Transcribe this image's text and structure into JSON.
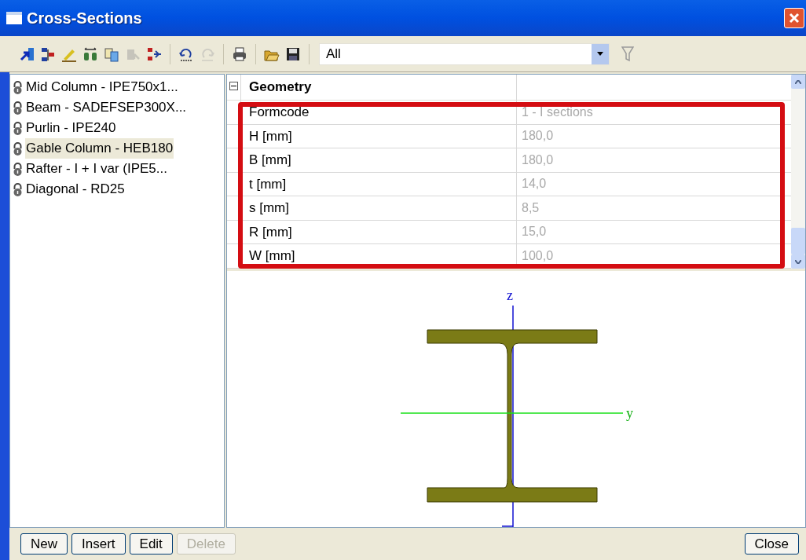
{
  "window": {
    "title": "Cross-Sections"
  },
  "toolbar": {
    "tools": [
      {
        "kind": "assign",
        "disabled": false
      },
      {
        "kind": "swap",
        "disabled": false
      },
      {
        "kind": "edit",
        "disabled": false
      },
      {
        "kind": "binoculars",
        "disabled": false
      },
      {
        "kind": "copy",
        "disabled": false
      },
      {
        "kind": "pointer",
        "disabled": true
      },
      {
        "kind": "insert",
        "disabled": false
      },
      {
        "kind": "undo",
        "disabled": false
      },
      {
        "kind": "redo",
        "disabled": true
      },
      {
        "kind": "print",
        "disabled": false
      },
      {
        "kind": "open",
        "disabled": false
      },
      {
        "kind": "save",
        "disabled": false
      }
    ],
    "filter": {
      "value": "All"
    }
  },
  "sections": [
    {
      "label": "Mid Column - IPE750x1...",
      "selected": false
    },
    {
      "label": "Beam - SADEFSEP300X...",
      "selected": false
    },
    {
      "label": "Purlin - IPE240",
      "selected": false
    },
    {
      "label": "Gable Column - HEB180",
      "selected": true
    },
    {
      "label": "Rafter - I + I var (IPE5...",
      "selected": false
    },
    {
      "label": "Diagonal - RD25",
      "selected": false
    }
  ],
  "properties": {
    "group": "Geometry",
    "expanded": true,
    "rows": [
      {
        "name": "Formcode",
        "value": "1 - I sections"
      },
      {
        "name": "H [mm]",
        "value": "180,0"
      },
      {
        "name": "B [mm]",
        "value": "180,0"
      },
      {
        "name": "t [mm]",
        "value": "14,0"
      },
      {
        "name": "s [mm]",
        "value": "8,5"
      },
      {
        "name": "R [mm]",
        "value": "15,0"
      },
      {
        "name": "W [mm]",
        "value": "100,0"
      }
    ]
  },
  "drawing": {
    "axes": [
      {
        "label": "z"
      },
      {
        "label": "y"
      }
    ]
  },
  "buttons": [
    {
      "label": "New",
      "disabled": false
    },
    {
      "label": "Insert",
      "disabled": false
    },
    {
      "label": "Edit",
      "disabled": false
    },
    {
      "label": "Delete",
      "disabled": true
    }
  ],
  "close_button": {
    "label": "Close"
  }
}
